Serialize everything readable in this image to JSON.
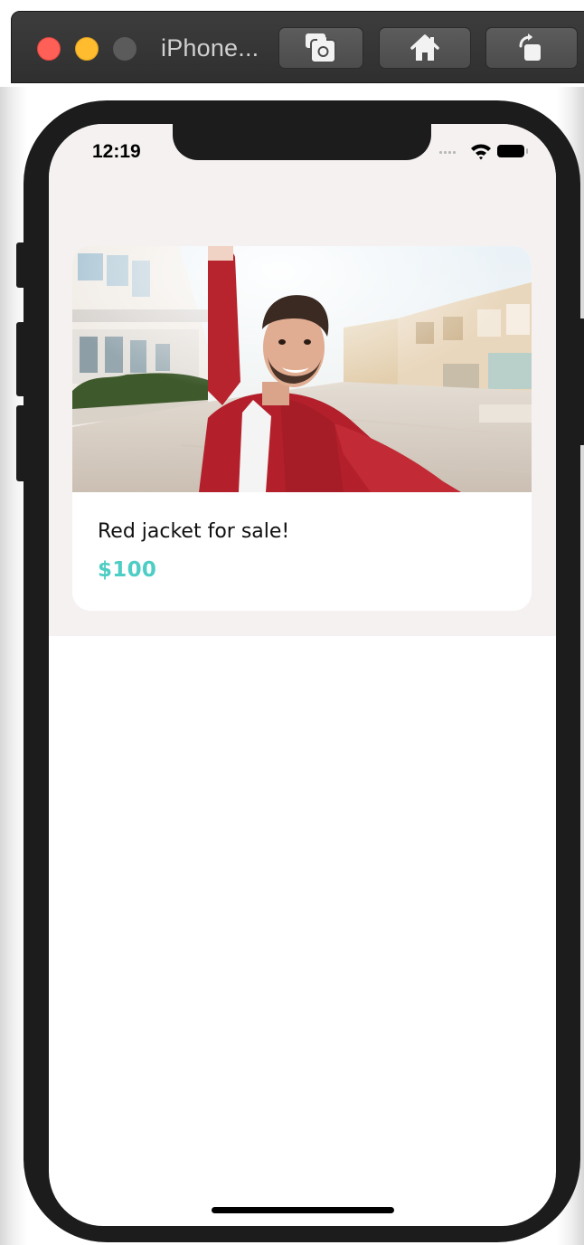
{
  "window": {
    "title": "iPhone...",
    "colors": {
      "close": "#fe5f57",
      "minimize": "#febc2e",
      "zoom": "#5b5b5b"
    },
    "toolbar_icons": [
      "screenshot-icon",
      "home-icon",
      "rotate-icon"
    ]
  },
  "status_bar": {
    "time": "12:19",
    "icons": [
      "signal-dots-icon",
      "wifi-icon",
      "battery-icon"
    ]
  },
  "listing": {
    "image_alt": "Man in red jacket taking a selfie on a street",
    "title": "Red jacket for sale!",
    "price": "$100",
    "price_color": "#4ecdc4"
  }
}
